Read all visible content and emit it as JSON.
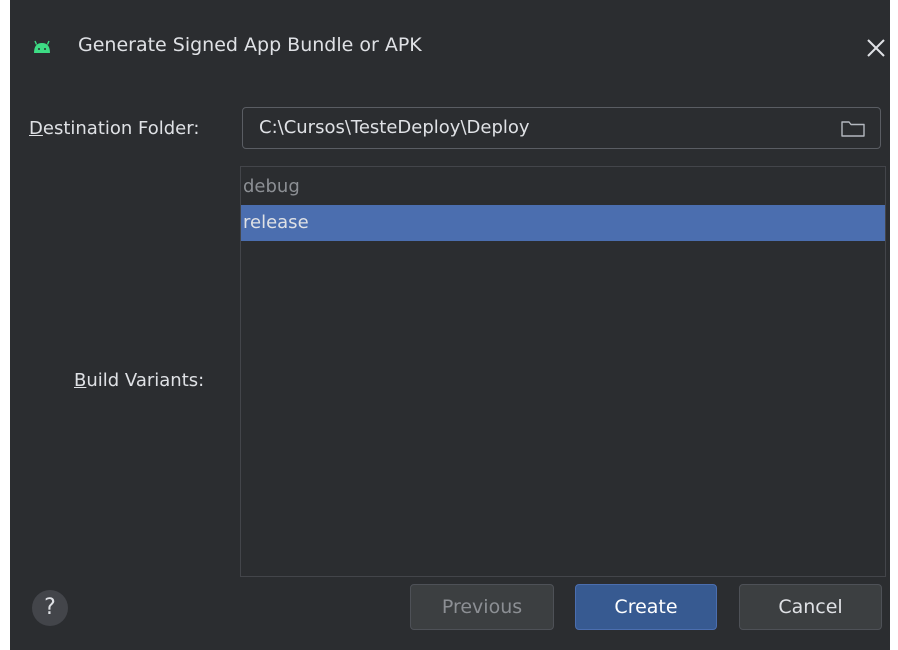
{
  "window": {
    "title": "Generate Signed App Bundle or APK",
    "icon": "android-icon",
    "close_icon": "close-icon"
  },
  "form": {
    "destination_label_mnemonic": "D",
    "destination_label_rest": "estination Folder:",
    "destination_value": "C:\\Cursos\\TesteDeploy\\Deploy",
    "browse_icon": "folder-icon",
    "build_variants_label_mnemonic": "B",
    "build_variants_label_rest": "uild Variants:",
    "build_variants": [
      {
        "label": "debug",
        "selected": false
      },
      {
        "label": "release",
        "selected": true
      }
    ]
  },
  "footer": {
    "help_label": "?",
    "previous_label": "Previous",
    "create_label": "Create",
    "cancel_label": "Cancel"
  },
  "colors": {
    "background": "#2b2d30",
    "selection": "#4b6eaf",
    "primary_button": "#375a91",
    "text": "#dfe1e5",
    "disabled_text": "#8c8f94",
    "android_green": "#3ddc84"
  }
}
